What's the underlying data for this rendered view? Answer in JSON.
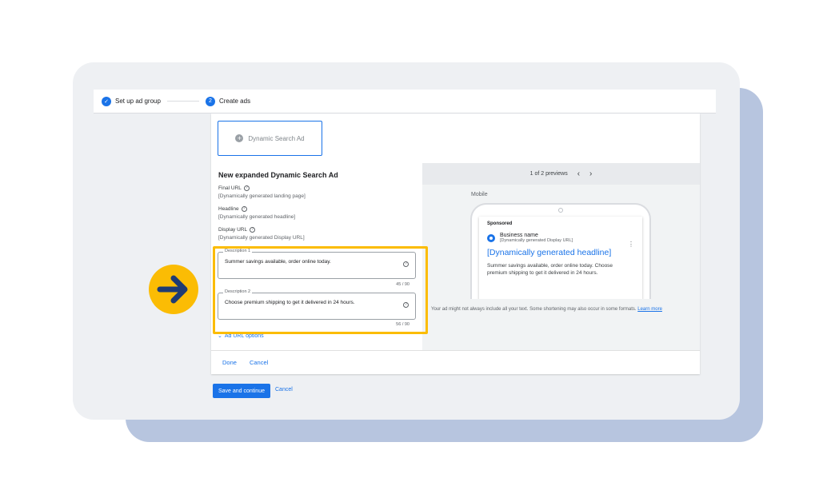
{
  "stepper": {
    "step1": {
      "label": "Set up ad group",
      "icon": "check-icon"
    },
    "step2": {
      "label": "Create ads",
      "number": "2"
    }
  },
  "ad_type": {
    "label": "Dynamic Search Ad",
    "icon": "plus-circle-icon"
  },
  "form": {
    "title": "New expanded Dynamic Search Ad",
    "final_url": {
      "label": "Final URL",
      "value": "[Dynamically generated landing page]"
    },
    "headline": {
      "label": "Headline",
      "value": "[Dynamically generated headline]"
    },
    "display_url": {
      "label": "Display URL",
      "value": "[Dynamically generated Display URL]"
    },
    "description1": {
      "label": "Description 1",
      "value": "Summer savings available, order online today.",
      "counter": "45 / 90"
    },
    "description2": {
      "label": "Description 2",
      "value": "Choose premium shipping to get it delivered in 24 hours.",
      "counter": "56 / 90"
    },
    "ad_url_options": "Ad URL options"
  },
  "preview": {
    "pager": "1 of 2 previews",
    "prev": "‹",
    "next": "›",
    "device": "Mobile",
    "sponsored": "Sponsored",
    "business_name": "Business name",
    "display_url": "[Dynamically generated Display URL]",
    "headline": "[Dynamically generated headline]",
    "description": "Summer savings available, order online today. Choose premium shipping to get it delivered in 24 hours.",
    "disclaimer": "Your ad might not always include all your text. Some shortening may also occur in some formats.",
    "learn_more": "Learn more"
  },
  "panel_footer": {
    "done": "Done",
    "cancel": "Cancel"
  },
  "actions": {
    "save": "Save and continue",
    "cancel": "Cancel"
  },
  "colors": {
    "accent": "#1a73e8",
    "highlight": "#fbbc04",
    "arrow": "#1f3b73"
  }
}
